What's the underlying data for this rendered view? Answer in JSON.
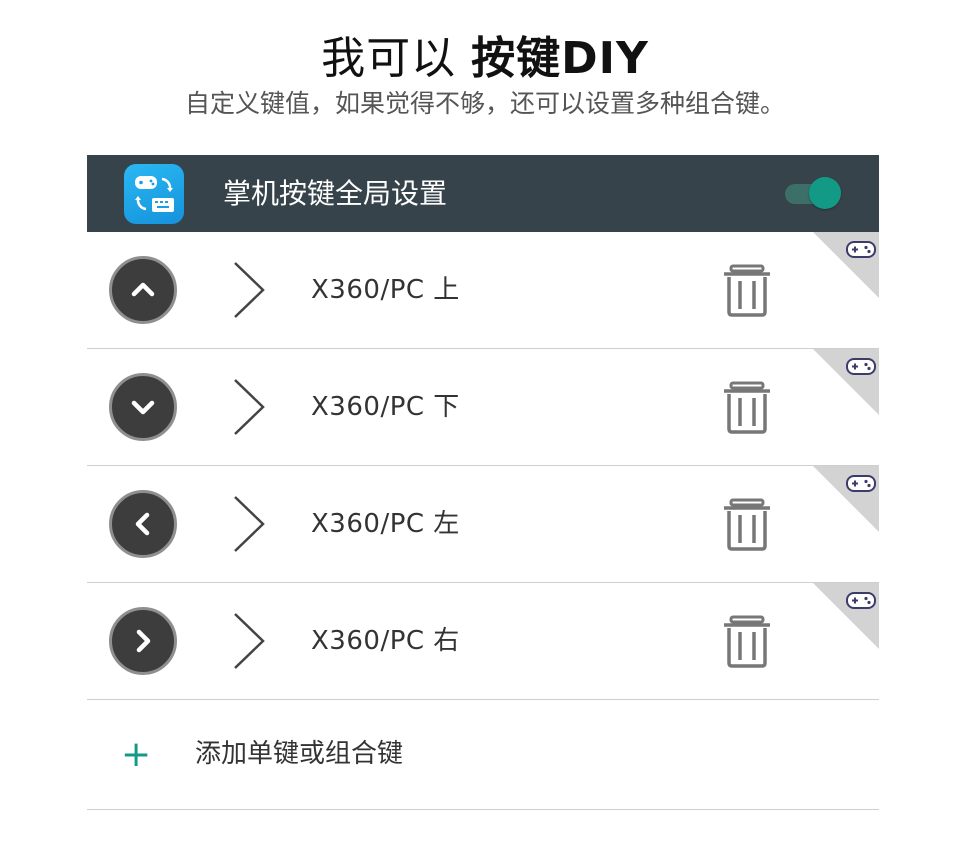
{
  "hero": {
    "title_regular": "我可以 ",
    "title_bold": "按键DIY",
    "subtitle": "自定义键值，如果觉得不够，还可以设置多种组合键。"
  },
  "header": {
    "title": "掌机按键全局设置",
    "toggle_on": true,
    "icon": "controller-keyboard-swap-icon"
  },
  "mappings": [
    {
      "direction": "up",
      "label": "X360/PC 上"
    },
    {
      "direction": "down",
      "label": "X360/PC 下"
    },
    {
      "direction": "left",
      "label": "X360/PC 左"
    },
    {
      "direction": "right",
      "label": "X360/PC 右"
    }
  ],
  "add": {
    "icon_text": "+",
    "label": "添加单键或组合键"
  },
  "colors": {
    "header_bg": "#37434a",
    "accent": "#139a87",
    "button_bg": "#3d3d3d"
  }
}
